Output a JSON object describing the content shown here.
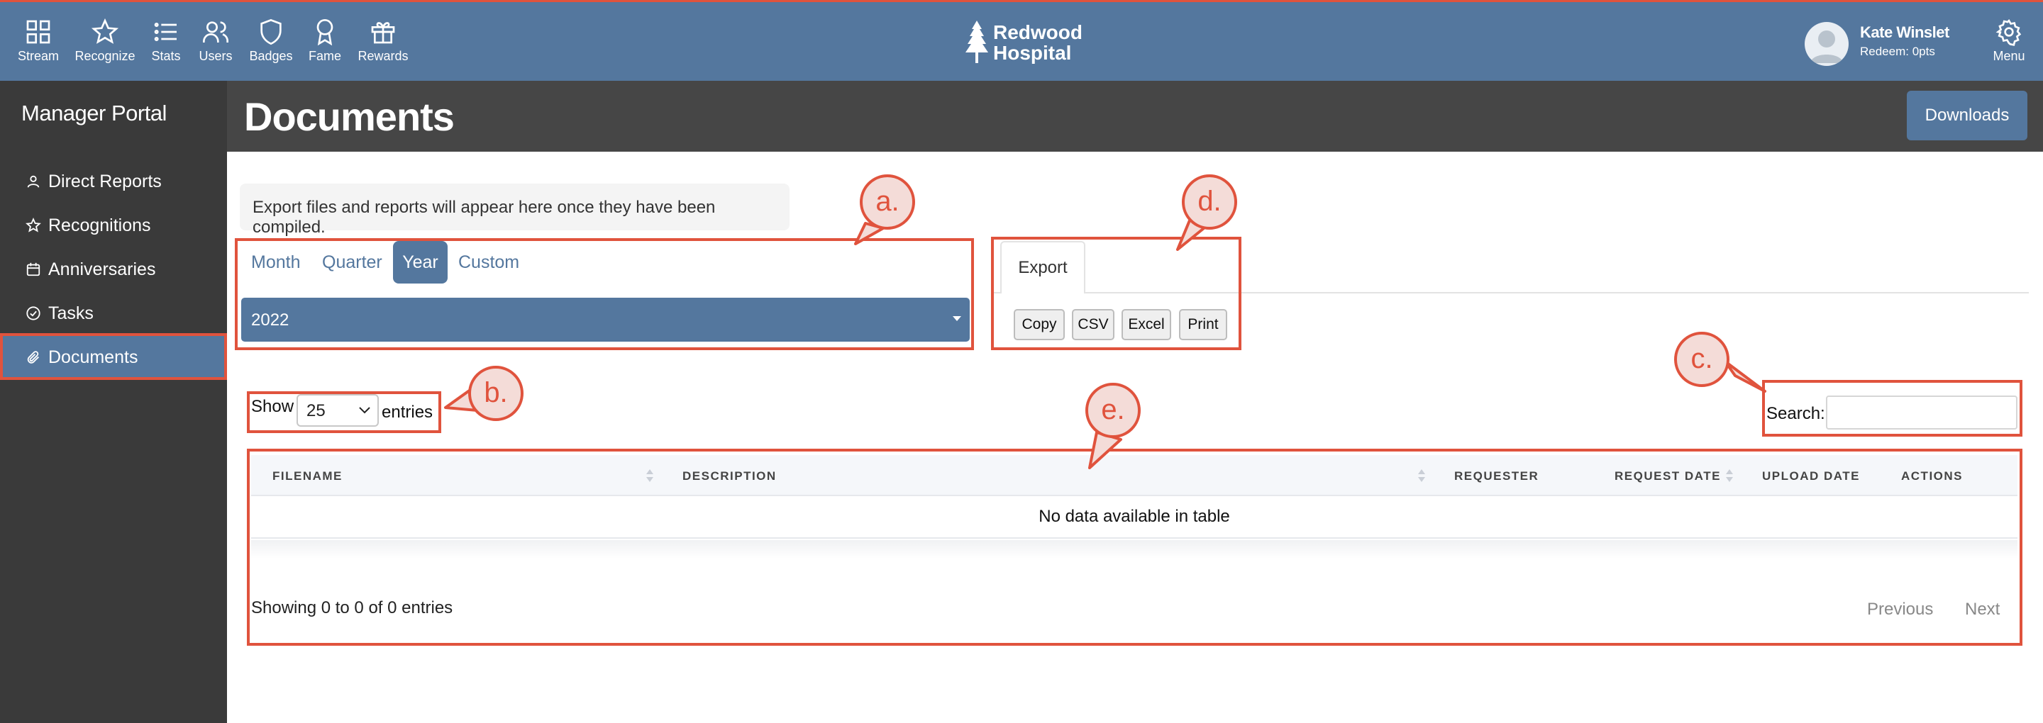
{
  "nav": {
    "items": [
      {
        "label": "Stream",
        "icon": "grid-icon"
      },
      {
        "label": "Recognize",
        "icon": "star-icon"
      },
      {
        "label": "Stats",
        "icon": "list-icon"
      },
      {
        "label": "Users",
        "icon": "users-icon"
      },
      {
        "label": "Badges",
        "icon": "shield-icon"
      },
      {
        "label": "Fame",
        "icon": "award-icon"
      },
      {
        "label": "Rewards",
        "icon": "gift-icon"
      }
    ],
    "brand_line1": "Redwood",
    "brand_line2": "Hospital",
    "user_name": "Kate Winslet",
    "user_points": "Redeem: 0pts",
    "menu_label": "Menu"
  },
  "sidebar": {
    "title": "Manager Portal",
    "items": [
      {
        "label": "Direct Reports",
        "icon": "user-icon"
      },
      {
        "label": "Recognitions",
        "icon": "star-icon"
      },
      {
        "label": "Anniversaries",
        "icon": "calendar-icon"
      },
      {
        "label": "Tasks",
        "icon": "check-circle-icon"
      },
      {
        "label": "Documents",
        "icon": "paperclip-icon",
        "active": true
      }
    ]
  },
  "header": {
    "title": "Documents",
    "downloads_label": "Downloads"
  },
  "info_message": "Export files and reports will appear here once they have been compiled.",
  "period": {
    "tabs": [
      "Month",
      "Quarter",
      "Year",
      "Custom"
    ],
    "active_tab": "Year",
    "selected_year": "2022"
  },
  "export": {
    "tab_label": "Export",
    "buttons": [
      "Copy",
      "CSV",
      "Excel",
      "Print"
    ]
  },
  "table_controls": {
    "show_label": "Show",
    "entries_value": "25",
    "entries_label": "entries",
    "search_label": "Search:",
    "search_value": ""
  },
  "table": {
    "columns": [
      "FILENAME",
      "DESCRIPTION",
      "REQUESTER",
      "REQUEST DATE",
      "UPLOAD DATE",
      "ACTIONS"
    ],
    "empty_message": "No data available in table",
    "info": "Showing 0 to 0 of 0 entries",
    "prev_label": "Previous",
    "next_label": "Next"
  },
  "annotations": {
    "a": "a.",
    "b": "b.",
    "c": "c.",
    "d": "d.",
    "e": "e."
  },
  "colors": {
    "primary": "#54779e",
    "annotation_red": "#e0533d",
    "sidebar_bg": "#3a3a3a",
    "header_bg": "#464646"
  }
}
